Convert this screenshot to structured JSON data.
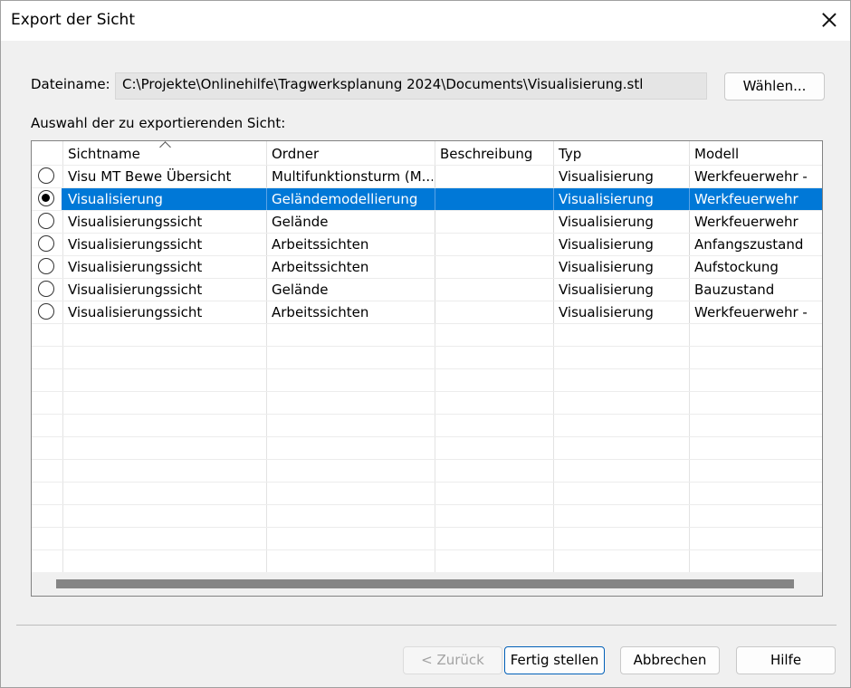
{
  "window": {
    "title": "Export der Sicht"
  },
  "file": {
    "label": "Dateiname:",
    "value": "C:\\Projekte\\Onlinehilfe\\Tragwerksplanung 2024\\Documents\\Visualisierung.stl",
    "browse_label": "Wählen..."
  },
  "selection_label": "Auswahl der zu exportierenden Sicht:",
  "table": {
    "columns": [
      "Sichtname",
      "Ordner",
      "Beschreibung",
      "Typ",
      "Modell"
    ],
    "sorted_column": "Sichtname",
    "rows": [
      {
        "checked": false,
        "selected": false,
        "name": "Visu MT Bewe Übersicht",
        "folder": "Multifunktionsturm (M...",
        "description": "",
        "type": "Visualisierung",
        "model": "Werkfeuerwehr -"
      },
      {
        "checked": true,
        "selected": true,
        "name": "Visualisierung",
        "folder": "Geländemodellierung",
        "description": "",
        "type": "Visualisierung",
        "model": "Werkfeuerwehr"
      },
      {
        "checked": false,
        "selected": false,
        "name": "Visualisierungssicht",
        "folder": "Gelände",
        "description": "",
        "type": "Visualisierung",
        "model": "Werkfeuerwehr"
      },
      {
        "checked": false,
        "selected": false,
        "name": "Visualisierungssicht",
        "folder": "Arbeitssichten",
        "description": "",
        "type": "Visualisierung",
        "model": "Anfangszustand"
      },
      {
        "checked": false,
        "selected": false,
        "name": "Visualisierungssicht",
        "folder": "Arbeitssichten",
        "description": "",
        "type": "Visualisierung",
        "model": "Aufstockung"
      },
      {
        "checked": false,
        "selected": false,
        "name": "Visualisierungssicht",
        "folder": "Gelände",
        "description": "",
        "type": "Visualisierung",
        "model": "Bauzustand"
      },
      {
        "checked": false,
        "selected": false,
        "name": "Visualisierungssicht",
        "folder": "Arbeitssichten",
        "description": "",
        "type": "Visualisierung",
        "model": "Werkfeuerwehr -"
      }
    ]
  },
  "buttons": {
    "back": "< Zurück",
    "finish": "Fertig stellen",
    "cancel": "Abbrechen",
    "help": "Hilfe"
  },
  "colors": {
    "selection": "#0078d7",
    "accent_border": "#005fb8"
  },
  "icons": {
    "close": "close-icon",
    "sort": "sort-ascending-icon",
    "radio": "radio-button"
  }
}
